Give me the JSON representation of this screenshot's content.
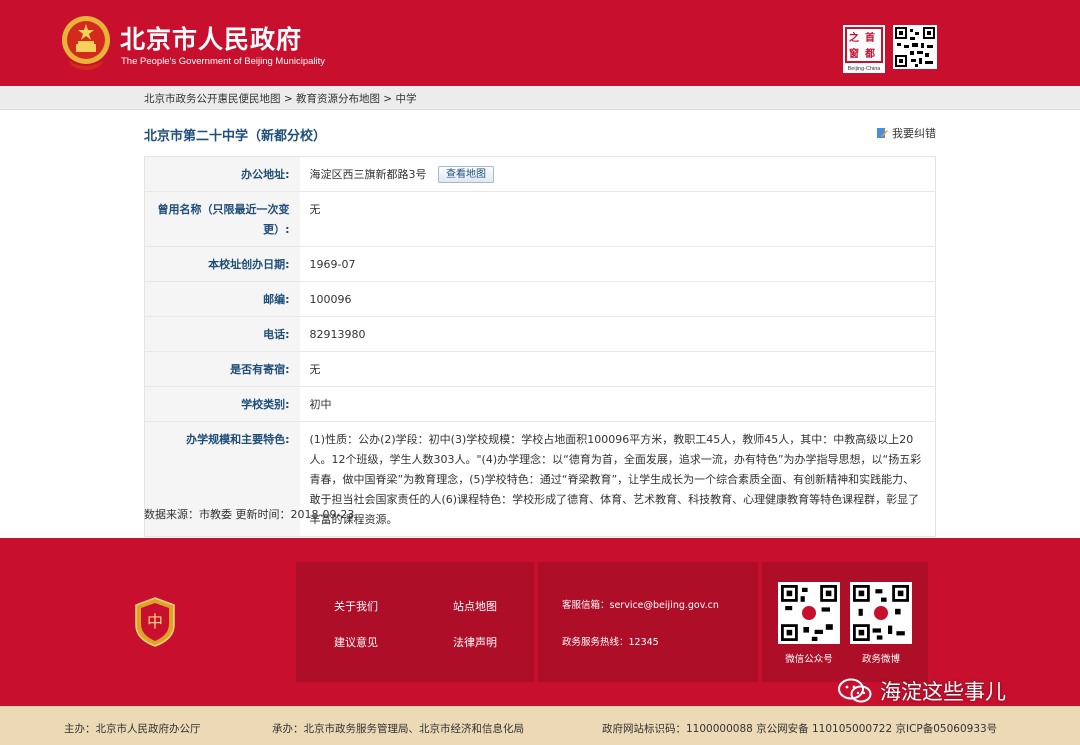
{
  "header": {
    "title": "北京市人民政府",
    "subtitle": "The People's Government of Beijing Municipality",
    "capital_logo": {
      "chars": [
        "首",
        "都",
        "之",
        "窗"
      ],
      "caption": "Beijing-China"
    },
    "colors": {
      "brand_red": "#c8102e"
    }
  },
  "breadcrumb": "北京市政务公开惠民便民地图 > 教育资源分布地图 > 中学",
  "page": {
    "title": "北京市第二十中学（新都分校）",
    "report_label": "我要纠错"
  },
  "info_rows": [
    {
      "label": "办公地址:",
      "value": "海淀区西三旗新都路3号",
      "button": "查看地图"
    },
    {
      "label": "曾用名称（只限最近一次变更）:",
      "value": "无"
    },
    {
      "label": "本校址创办日期:",
      "value": "1969-07"
    },
    {
      "label": "邮编:",
      "value": "100096"
    },
    {
      "label": "电话:",
      "value": "82913980"
    },
    {
      "label": "是否有寄宿:",
      "value": "无"
    },
    {
      "label": "学校类别:",
      "value": "初中"
    },
    {
      "label": "办学规模和主要特色:",
      "value": "(1)性质：公办(2)学段：初中(3)学校规模：学校占地面积100096平方米，教职工45人，教师45人，其中：中教高级以上20人。12个班级，学生人数303人。\"(4)办学理念：以“德育为首，全面发展，追求一流，办有特色”为办学指导思想，以“扬五彩青春，做中国脊梁”为教育理念，(5)学校特色：通过“脊梁教育”，让学生成长为一个综合素质全面、有创新精神和实践能力、敢于担当社会国家责任的人(6)课程特色：学校形成了德育、体育、艺术教育、科技教育、心理健康教育等特色课程群，彰显了丰富的课程资源。"
    }
  ],
  "source": "数据来源：市教委  更新时间：2018-09-23",
  "footer": {
    "links": [
      "关于我们",
      "站点地图",
      "建议意见",
      "法律声明"
    ],
    "email": "客服信箱：service@beijing.gov.cn",
    "hotline": "政务服务热线：12345",
    "qr_labels": [
      "微信公众号",
      "政务微博"
    ]
  },
  "watermark": "海淀这些事儿",
  "bottom_bar": {
    "host": "主办：北京市人民政府办公厅",
    "organizer": "承办：北京市政务服务管理局、北京市经济和信息化局",
    "ids": "政府网站标识码：1100000088 京公网安备 110105000722 京ICP备05060933号"
  }
}
